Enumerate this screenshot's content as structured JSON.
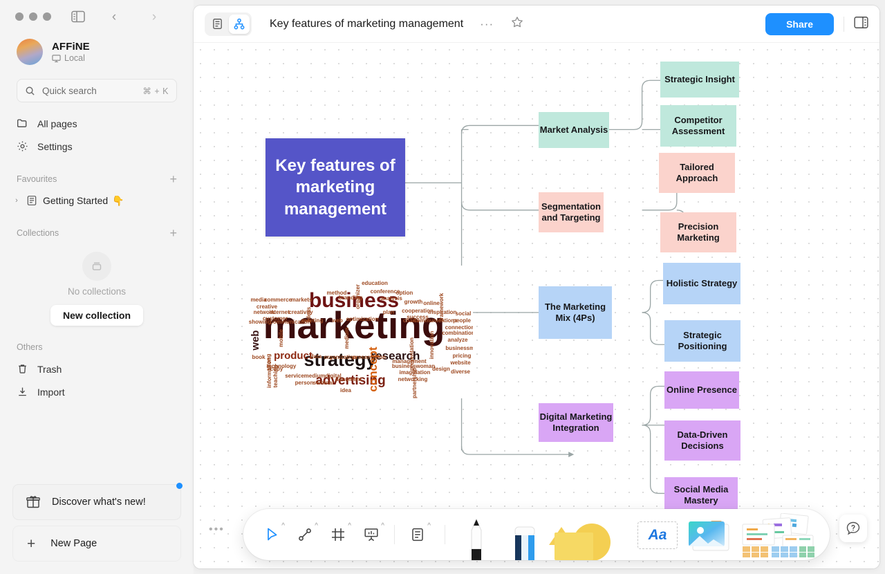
{
  "window": {
    "traffic_lights": [
      "close",
      "minimize",
      "maximize"
    ],
    "sidebar_toggle_icon": "sidebar-toggle-icon",
    "nav_back_icon": "chevron-left-icon",
    "nav_forward_icon": "chevron-right-icon"
  },
  "sidebar": {
    "workspace": {
      "name": "AFFiNE",
      "sub": "Local",
      "sub_icon": "monitor-icon"
    },
    "search": {
      "label": "Quick search",
      "shortcut": "⌘ + K",
      "icon": "search-icon"
    },
    "nav": [
      {
        "label": "All pages",
        "icon": "folder-icon"
      },
      {
        "label": "Settings",
        "icon": "gear-icon"
      }
    ],
    "sections": {
      "favourites": {
        "title": "Favourites",
        "add_label": "+",
        "items": [
          {
            "label": "Getting Started",
            "emoji": "👇",
            "icon": "doc-icon"
          }
        ]
      },
      "collections": {
        "title": "Collections",
        "add_label": "+",
        "empty_text": "No collections",
        "empty_icon": "collection-icon",
        "new_button": "New collection"
      },
      "others": {
        "title": "Others",
        "items": [
          {
            "label": "Trash",
            "icon": "trash-icon"
          },
          {
            "label": "Import",
            "icon": "import-icon"
          }
        ]
      }
    },
    "bottom": {
      "discover": {
        "label": "Discover what's new!",
        "icon": "gift-icon",
        "badge_color": "#1e90ff"
      },
      "new_page": {
        "label": "New Page",
        "icon": "plus-icon"
      }
    }
  },
  "header": {
    "mode_page_icon": "page-mode-icon",
    "mode_edgeless_icon": "edgeless-mode-icon",
    "active_mode": "edgeless",
    "title": "Key features of marketing management",
    "more_label": "···",
    "star_icon": "star-icon",
    "share_label": "Share",
    "share_color": "#1e90ff",
    "right_panel_icon": "right-sidebar-icon"
  },
  "mindmap": {
    "root": {
      "text": "Key features of marketing management",
      "color": "#5555c8",
      "text_color": "#ffffff"
    },
    "branches": [
      {
        "label": "Market Analysis",
        "color": "#bfe8dc",
        "children": [
          {
            "label": "Strategic Insight",
            "color": "#bfe8dc"
          },
          {
            "label": "Competitor Assessment",
            "color": "#bfe8dc"
          }
        ]
      },
      {
        "label": "Segmentation and Targeting",
        "color": "#fbd3cc",
        "children": [
          {
            "label": "Tailored Approach",
            "color": "#fbd3cc"
          },
          {
            "label": "Precision Marketing",
            "color": "#fbd3cc"
          }
        ]
      },
      {
        "label": "The Marketing Mix (4Ps)",
        "color": "#b6d4f7",
        "children": [
          {
            "label": "Holistic Strategy",
            "color": "#b6d4f7"
          },
          {
            "label": "Strategic Positioning",
            "color": "#b6d4f7"
          }
        ]
      },
      {
        "label": "Digital Marketing Integration",
        "color": "#d9a6f5",
        "children": [
          {
            "label": "Online Presence",
            "color": "#d9a6f5"
          },
          {
            "label": "Data-Driven Decisions",
            "color": "#d9a6f5"
          },
          {
            "label": "Social Media Mastery",
            "color": "#d9a6f5"
          }
        ]
      }
    ]
  },
  "wordcloud": {
    "alt": "marketing word cloud image",
    "primary_word": "marketing",
    "words": [
      "marketing",
      "business",
      "strategy",
      "advertising",
      "research",
      "concept",
      "product",
      "web",
      "media",
      "commerce",
      "markets",
      "creative",
      "network",
      "internet",
      "customer",
      "creativity",
      "communication",
      "showing",
      "meeting",
      "web",
      "optimization",
      "growth",
      "online",
      "cooperation",
      "success",
      "inspiration",
      "social",
      "people",
      "plan",
      "charts",
      "communications",
      "connection",
      "combination",
      "analyze",
      "businessman",
      "pricing",
      "website",
      "diverse",
      "design",
      "networking",
      "imagination",
      "businesswoman",
      "management",
      "organization",
      "presentation",
      "data",
      "technology",
      "service",
      "medium",
      "digital",
      "document",
      "person",
      "seminar",
      "idea",
      "copy",
      "information",
      "teaching",
      "strong",
      "book",
      "mobile",
      "ideas",
      "branding",
      "method",
      "organizer",
      "conference",
      "option",
      "analysis",
      "education",
      "innovation",
      "partnership",
      "promotion",
      "framework"
    ]
  },
  "toolbar": {
    "left_tools": [
      {
        "name": "select-tool",
        "icon": "cursor-arrow-icon",
        "active": true,
        "has_caret": true
      },
      {
        "name": "connector-tool",
        "icon": "connector-icon",
        "active": false,
        "has_caret": true
      },
      {
        "name": "frame-tool",
        "icon": "frame-icon",
        "active": false,
        "has_caret": true
      },
      {
        "name": "present-tool",
        "icon": "presentation-icon",
        "active": false,
        "has_caret": true
      },
      {
        "name": "note-tool",
        "icon": "note-icon",
        "active": false,
        "has_caret": true
      }
    ],
    "right_tools": [
      {
        "name": "pen-tool",
        "icon": "pencil-icon"
      },
      {
        "name": "eraser-tool",
        "icon": "eraser-icon"
      },
      {
        "name": "shape-tool",
        "icon": "shapes-icon"
      },
      {
        "name": "text-tool",
        "icon": "text-aa-icon",
        "label": "Aa"
      },
      {
        "name": "image-tool",
        "icon": "image-icon"
      },
      {
        "name": "template-tool",
        "icon": "template-cards-icon"
      }
    ],
    "help_label": "?",
    "canvas_menu_dots": "•••"
  }
}
